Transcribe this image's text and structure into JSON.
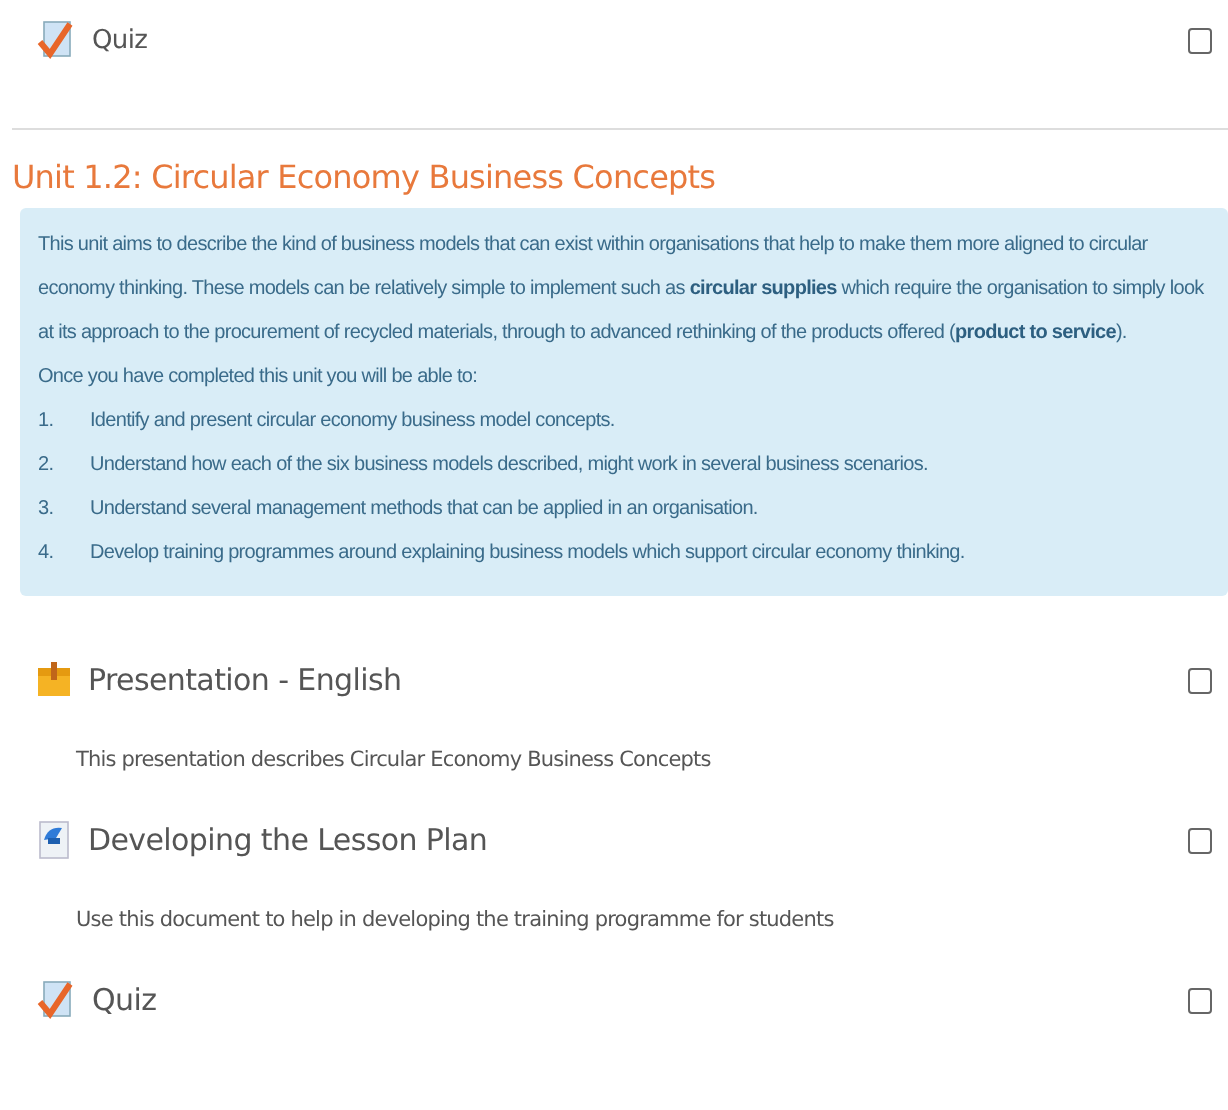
{
  "top_activity": {
    "kind": "quiz",
    "title": "Quiz",
    "checked": false
  },
  "unit": {
    "title": "Unit 1.2: Circular Economy Business Concepts",
    "intro": "This unit aims to describe the kind of business models that can exist within organisations that help to make them more aligned to circular economy thinking.  These models can be relatively simple to implement such as **circular supplies** which require the organisation to simply look at its approach to the procurement of recycled materials, through to advanced rethinking of the products offered (**product to service**).",
    "lead": "Once you have completed this unit you will be able to:",
    "outcomes": [
      {
        "number": "1.",
        "text": "Identify and present circular economy business model concepts."
      },
      {
        "number": "2.",
        "text": "Understand how each of the six business models described, might work in several business scenarios."
      },
      {
        "number": "3.",
        "text": "Understand several management methods that can be applied in an organisation."
      },
      {
        "number": "4.",
        "text": "Develop training programmes around explaining business models which support circular economy thinking."
      }
    ]
  },
  "activities": [
    {
      "kind": "presentation",
      "title": "Presentation - English",
      "description": "This presentation describes Circular Economy Business Concepts",
      "checked": false
    },
    {
      "kind": "document",
      "title": "Developing the Lesson Plan",
      "description": "Use this document to help in developing the training programme for students",
      "checked": false
    },
    {
      "kind": "quiz",
      "title": "Quiz",
      "checked": false
    }
  ]
}
